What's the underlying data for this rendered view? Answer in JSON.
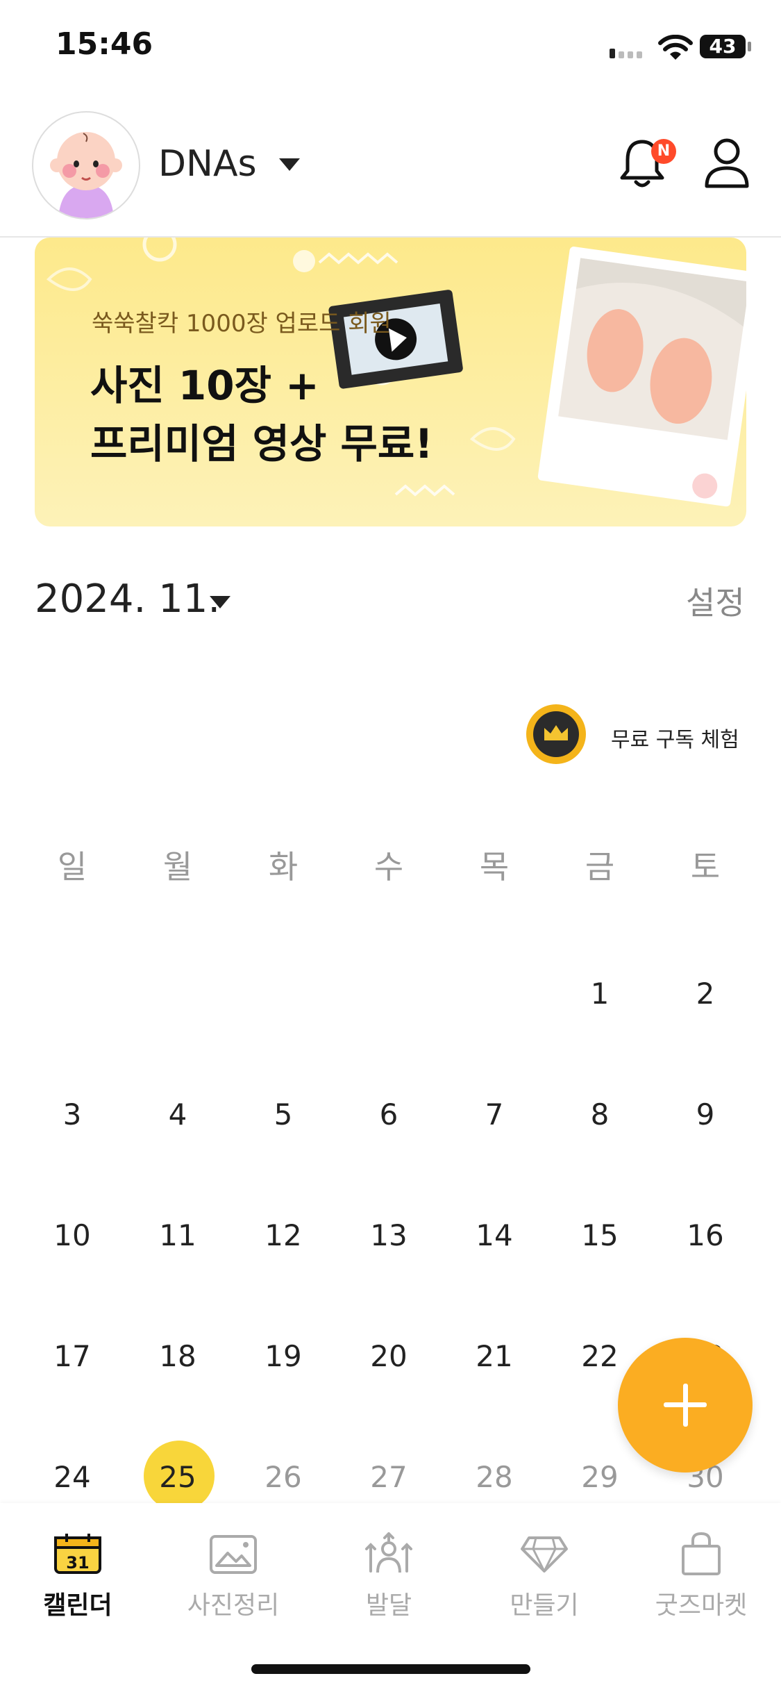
{
  "status_bar": {
    "time": "15:46",
    "battery": "43"
  },
  "header": {
    "profile_name": "DNAs",
    "notification_badge": "N"
  },
  "banner": {
    "subtitle": "쑥쑥찰칵 1000장 업로드 회원",
    "title_line1": "사진 10장 +",
    "title_line2": "프리미엄 영상 무료!"
  },
  "calendar": {
    "month": "2024. 11.",
    "settings": "설정",
    "trial": "무료 구독 체험",
    "weekdays": [
      "일",
      "월",
      "화",
      "수",
      "목",
      "금",
      "토"
    ],
    "days": [
      "1",
      "2",
      "3",
      "4",
      "5",
      "6",
      "7",
      "8",
      "9",
      "10",
      "11",
      "12",
      "13",
      "14",
      "15",
      "16",
      "17",
      "18",
      "19",
      "20",
      "21",
      "22",
      "23",
      "24",
      "25",
      "26",
      "27",
      "28",
      "29",
      "30"
    ],
    "today": "25"
  },
  "tabs": [
    {
      "label": "캘린더",
      "icon": "calendar-icon",
      "icon_text": "31"
    },
    {
      "label": "사진정리",
      "icon": "photo-icon"
    },
    {
      "label": "발달",
      "icon": "growth-icon"
    },
    {
      "label": "만들기",
      "icon": "diamond-icon"
    },
    {
      "label": "굿즈마켓",
      "icon": "shopping-bag-icon"
    }
  ],
  "colors": {
    "accent": "#fbad22",
    "today": "#f8d63a",
    "banner": "#fde98b"
  }
}
